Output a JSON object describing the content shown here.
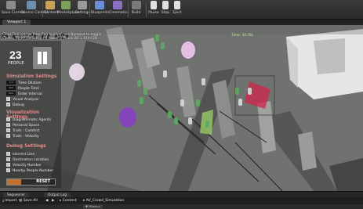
{
  "toolbar": {
    "buttons": [
      {
        "label": "Save Current",
        "color": "#8a8a8a"
      },
      {
        "label": "Source Control",
        "color": "#6d8fb0"
      },
      {
        "label": "Content",
        "color": "#c9a25a"
      },
      {
        "label": "Marketplace",
        "color": "#7aa05a"
      },
      {
        "label": "Settings",
        "color": "#9a9a9a"
      },
      {
        "label": "Blueprints",
        "color": "#6b8ed6"
      },
      {
        "label": "Cinematics",
        "color": "#8a70c0"
      },
      {
        "label": "Build",
        "color": "#7a7a7a"
      },
      {
        "label": "Pause",
        "color": "#e0e0e0"
      },
      {
        "label": "Stop",
        "color": "#e0e0e0"
      },
      {
        "label": "Eject",
        "color": "#e0e0e0"
      }
    ]
  },
  "tab": {
    "label": "Viewport 1"
  },
  "viewport_toolbar": {
    "perspective": "Perspective",
    "lit": "Lit",
    "show": "Show"
  },
  "hint": {
    "line1": "Clear Debugdraw then flag to clear, use Numpad to toggle",
    "line2": "Eject = Alt+P  Detach = F8  Pause = Pause  2D = Ctrl+2D"
  },
  "fps": "Time: 34.78s",
  "hud": {
    "people_count": "23",
    "people_label": "PEOPLE",
    "sections": {
      "simulation": {
        "title": "Simulation Settings",
        "rows": [
          {
            "tag": "1.0",
            "label": "Time Dilation"
          },
          {
            "tag": "300",
            "label": "People Total"
          },
          {
            "tag": "30.0",
            "label": "Enter Interval"
          },
          {
            "check": "✓",
            "label": "Visual Analysis"
          },
          {
            "check": "✓",
            "label": "Debug"
          }
        ]
      },
      "visualization": {
        "title": "Visualization Settings",
        "rows": [
          {
            "check": "✓",
            "label": "Diagrammatic Agents"
          },
          {
            "check": "✓",
            "label": "Personal Space"
          },
          {
            "check": "✓",
            "label": "Trails - Comfort"
          },
          {
            "check": "✓",
            "label": "Trails - Velocity"
          }
        ]
      },
      "debug": {
        "title": "Debug Settings",
        "rows": [
          {
            "check": "✓",
            "label": "Interest Line"
          },
          {
            "check": "✓",
            "label": "Destination Location"
          },
          {
            "check": "✓",
            "label": "Velocity Number"
          },
          {
            "check": "✓",
            "label": "Nearby People Number"
          }
        ]
      }
    },
    "reset_label": "RESET",
    "reset_progress": 0.3
  },
  "bottom_tabs": {
    "sequencer": "Sequencer",
    "output_log": "Output Log"
  },
  "content_bar": {
    "import": "Import",
    "save_all": "Save All",
    "content": "Content",
    "folder": "AV_Crowd_Simulation"
  },
  "filters": {
    "label": "▼ Filters ▸"
  },
  "colors": {
    "accent_red": "#e48a8a",
    "progress_orange": "#c07030"
  }
}
